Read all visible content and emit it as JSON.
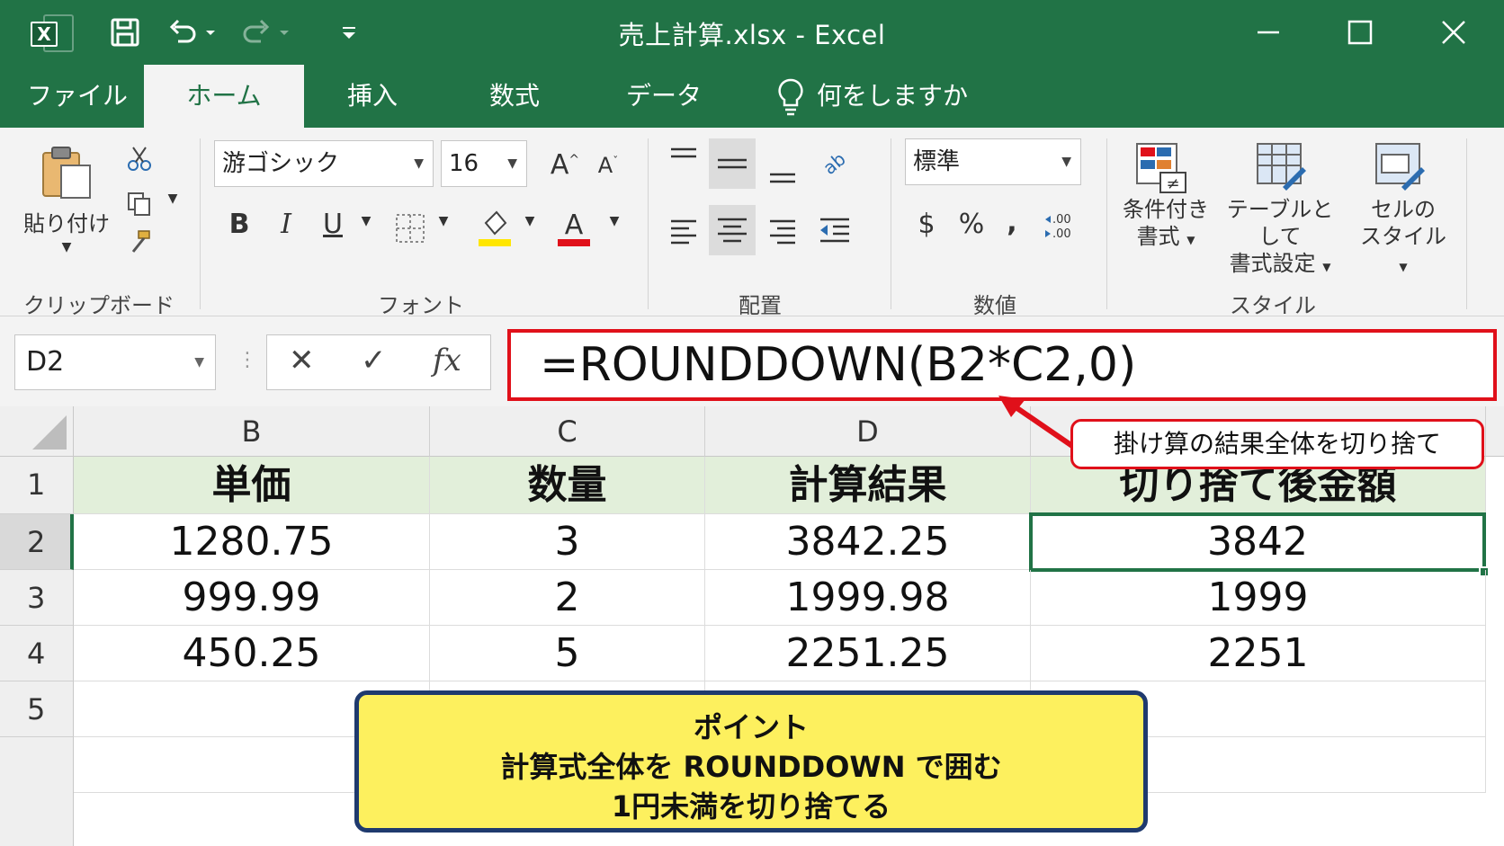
{
  "window": {
    "title": "売上計算.xlsx  -  Excel",
    "app_icon_letter": "X"
  },
  "tabs": [
    {
      "label": "ファイル"
    },
    {
      "label": "ホーム"
    },
    {
      "label": "挿入"
    },
    {
      "label": "数式"
    },
    {
      "label": "データ"
    }
  ],
  "tell_me": "何をしますか",
  "ribbon": {
    "clipboard": {
      "paste_label": "貼り付け",
      "group": "クリップボード"
    },
    "font": {
      "name": "游ゴシック",
      "size": "16",
      "group": "フォント"
    },
    "alignment": {
      "group": "配置"
    },
    "number": {
      "format": "標準",
      "group": "数値"
    },
    "styles": {
      "conditional_line1": "条件付き",
      "conditional_line2": "書式",
      "table_line1": "テーブルとして",
      "table_line2": "書式設定",
      "cell_line1": "セルの",
      "cell_line2": "スタイル",
      "group": "スタイル"
    }
  },
  "formula_bar": {
    "name_box": "D2",
    "formula": "=ROUNDDOWN(B2*C2,0)"
  },
  "sheet": {
    "columns": [
      "B",
      "C",
      "D",
      ""
    ],
    "rows": [
      "1",
      "2",
      "3",
      "4",
      "5"
    ],
    "header": [
      "単価",
      "数量",
      "計算結果",
      "切り捨て後金額"
    ],
    "data": [
      [
        "1280.75",
        "3",
        "3842.25",
        "3842"
      ],
      [
        "999.99",
        "2",
        "1999.98",
        "1999"
      ],
      [
        "450.25",
        "5",
        "2251.25",
        "2251"
      ]
    ]
  },
  "annotations": {
    "callout": "掛け算の結果全体を切り捨て",
    "note_line1": "ポイント",
    "note_line2": "計算式全体を  ROUNDDOWN で囲む",
    "note_line3": "1円未満を切り捨てる"
  },
  "colors": {
    "excel_green": "#217346",
    "highlight_red": "#e0101a",
    "note_yellow": "#fdf05e",
    "note_border": "#1f3a6e",
    "header_fill": "#e2efda"
  }
}
